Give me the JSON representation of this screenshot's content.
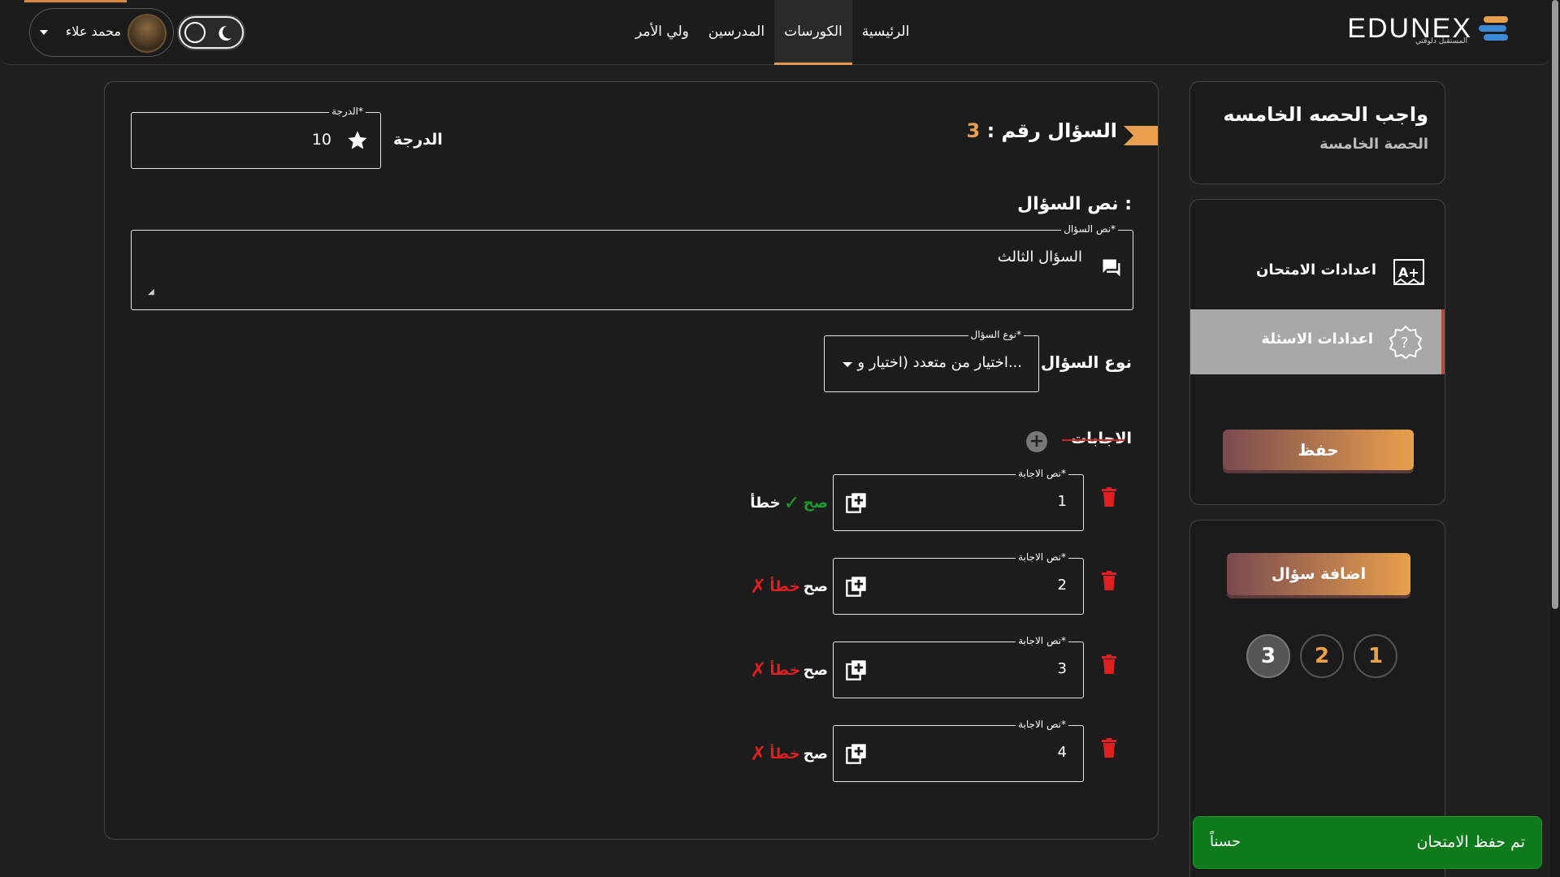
{
  "brand": {
    "name": "EDUNEX",
    "tagline": "المستقبل دلوقتي",
    "accent": "#e8a04c"
  },
  "nav": {
    "items": [
      {
        "label": "الرئيسية",
        "active": false
      },
      {
        "label": "الكورسات",
        "active": true
      },
      {
        "label": "المدرسين",
        "active": false
      },
      {
        "label": "ولي الأمر",
        "active": false
      }
    ]
  },
  "user": {
    "name": "محمد علاء"
  },
  "lesson": {
    "title": "واجب الحصه الخامسه",
    "subtitle": "الحصة الخامسة"
  },
  "settings": {
    "exam_label": "اعدادات الامتحان",
    "questions_label": "اعدادات الاسئلة",
    "save_label": "حفظ"
  },
  "question_nav": {
    "add_label": "اضافة سؤال",
    "numbers": [
      "1",
      "2",
      "3"
    ],
    "active": "3"
  },
  "question": {
    "header_prefix": "السؤال رقم :",
    "number": "3",
    "score_label": "الدرجة",
    "score_legend": "الدرجة*",
    "score_value": "10",
    "text_title": "نص السؤال :",
    "text_legend": "نص السؤال*",
    "text_value": "السؤال الثالث",
    "type_label": "نوع السؤال",
    "type_legend": "نوع السؤال*",
    "type_value": "اختيار من متعدد (اختيار و..."
  },
  "answers": {
    "label": "الاجابات",
    "legend": "نص الاجابة*",
    "true_label": "صح",
    "false_label": "خطأ",
    "items": [
      {
        "value": "1",
        "correct": true
      },
      {
        "value": "2",
        "correct": false
      },
      {
        "value": "3",
        "correct": false
      },
      {
        "value": "4",
        "correct": false
      }
    ]
  },
  "toast": {
    "message": "تم حفظ الامتحان",
    "action": "حسناً"
  }
}
